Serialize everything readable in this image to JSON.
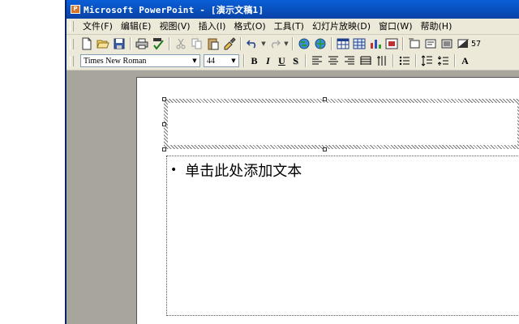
{
  "window": {
    "title": "Microsoft PowerPoint - [演示文稿1]"
  },
  "menu": {
    "items": [
      {
        "label": "文件(F)"
      },
      {
        "label": "编辑(E)"
      },
      {
        "label": "视图(V)"
      },
      {
        "label": "插入(I)"
      },
      {
        "label": "格式(O)"
      },
      {
        "label": "工具(T)"
      },
      {
        "label": "幻灯片放映(D)"
      },
      {
        "label": "窗口(W)"
      },
      {
        "label": "帮助(H)"
      }
    ]
  },
  "toolbar": {
    "zoom_label": "57"
  },
  "formatting": {
    "font_name": "Times New Roman",
    "font_size": "44",
    "bold": "B",
    "italic": "I",
    "underline": "U",
    "shadow": "S",
    "font_color_label": "A"
  },
  "slide": {
    "body_placeholder_text": "单击此处添加文本",
    "bullet": "•"
  },
  "colors": {
    "titlebar": "#0a5fd8",
    "workspace": "#a8a69c",
    "toolbar_bg": "#ece9d8"
  }
}
